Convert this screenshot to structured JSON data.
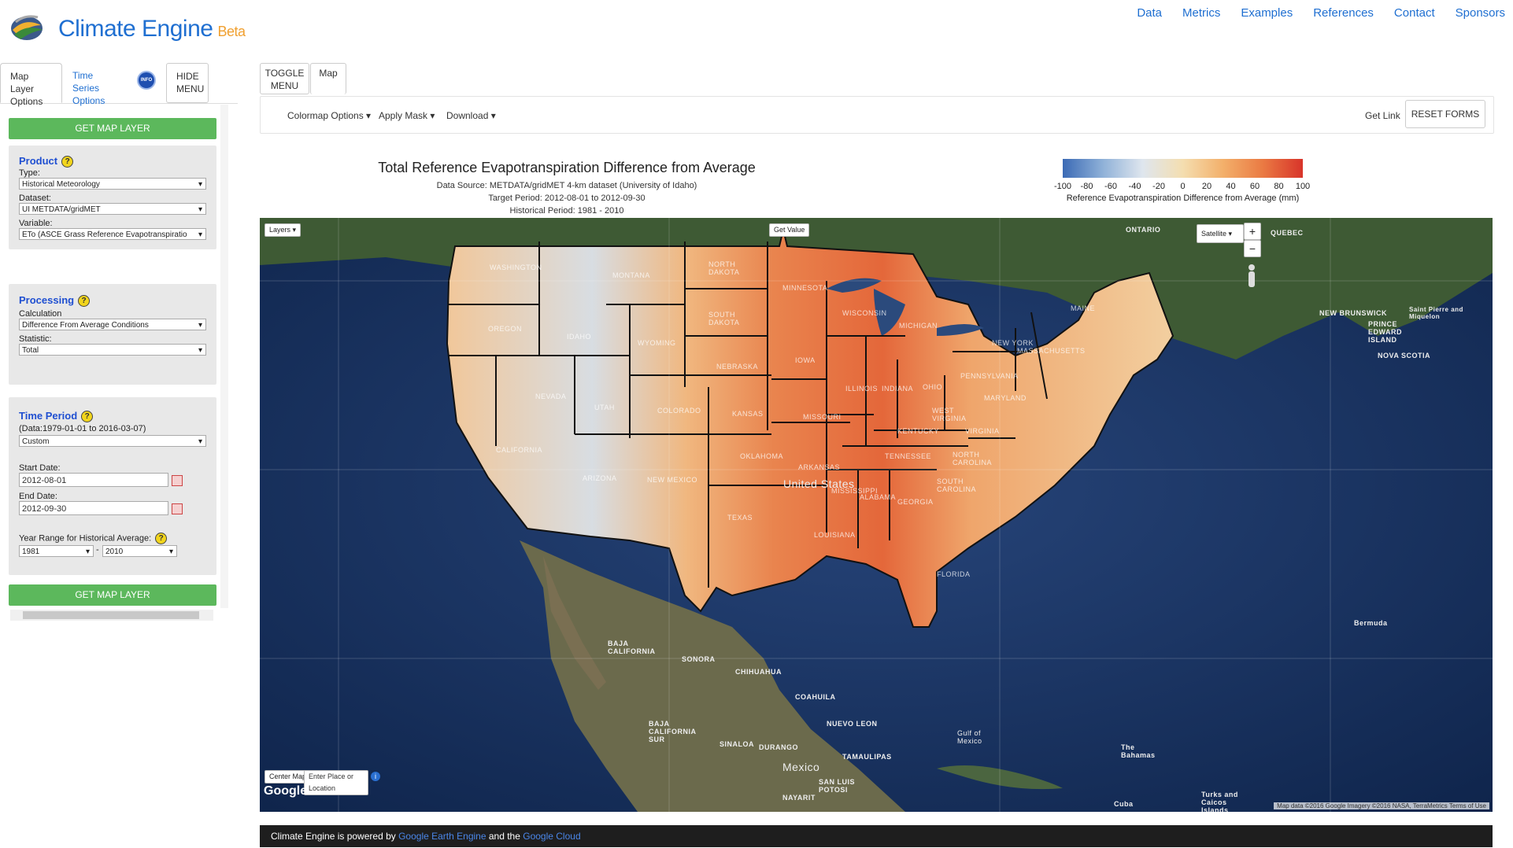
{
  "header": {
    "app_title": "Climate Engine",
    "beta": "Beta",
    "nav": [
      "Data",
      "Metrics",
      "Examples",
      "References",
      "Contact",
      "Sponsors"
    ]
  },
  "left_panel": {
    "tab_map_layer": "Map Layer Options",
    "tab_time_series": "Time Series Options",
    "info_icon_text": "INFO",
    "hide_menu": "HIDE MENU",
    "get_map_layer": "GET MAP LAYER",
    "product": {
      "title": "Product",
      "type_label": "Type:",
      "type_value": "Historical Meteorology",
      "dataset_label": "Dataset:",
      "dataset_value": "UI METDATA/gridMET",
      "variable_label": "Variable:",
      "variable_value": "ETo (ASCE Grass Reference Evapotranspiratio"
    },
    "processing": {
      "title": "Processing",
      "calculation_label": "Calculation",
      "calculation_value": "Difference From Average Conditions",
      "statistic_label": "Statistic:",
      "statistic_value": "Total"
    },
    "time_period": {
      "title": "Time Period",
      "data_range": "(Data:1979-01-01 to 2016-03-07)",
      "period_value": "Custom",
      "start_label": "Start Date:",
      "start_value": "2012-08-01",
      "end_label": "End Date:",
      "end_value": "2012-09-30",
      "year_range_label": "Year Range for Historical Average:",
      "year_start": "1981",
      "year_dash": "-",
      "year_end": "2010"
    }
  },
  "right_panel": {
    "toggle_menu": "TOGGLE MENU",
    "map_tab": "Map",
    "toolbar": {
      "colormap": "Colormap Options",
      "apply_mask": "Apply Mask",
      "download": "Download",
      "get_link": "Get Link",
      "reset_forms": "RESET FORMS"
    },
    "map_title": "Total Reference Evapotranspiration Difference from Average",
    "data_source": "Data Source: METDATA/gridMET 4-km dataset (University of Idaho)",
    "target_period": "Target Period: 2012-08-01 to 2012-09-30",
    "historical_period": "Historical Period: 1981 - 2010",
    "colorbar": {
      "ticks": [
        "-100",
        "-80",
        "-60",
        "-40",
        "-20",
        "0",
        "20",
        "40",
        "60",
        "80",
        "100"
      ],
      "label": "Reference Evapotranspiration Difference from Average (mm)",
      "colors": [
        "#3b6ab5",
        "#8fb1d8",
        "#dfe6ee",
        "#f4deb0",
        "#f3b06b",
        "#ea7a43",
        "#d8342a"
      ]
    },
    "map": {
      "layers_btn": "Layers",
      "get_value_btn": "Get Value",
      "satellite_select": "Satellite",
      "zoom_in": "+",
      "zoom_out": "−",
      "center_map_btn": "Center Map",
      "search_placeholder": "Enter Place or Location",
      "google": "Google",
      "attribution": "Map data ©2016 Google Imagery ©2016 NASA, TerraMetrics   Terms of Use",
      "country_label": "United States",
      "mexico_label": "Mexico",
      "place_labels": [
        "ONTARIO",
        "QUEBEC",
        "NEW BRUNSWICK",
        "PRINCE EDWARD ISLAND",
        "NOVA SCOTIA",
        "Saint Pierre and Miquelon",
        "Bermuda",
        "BAJA CALIFORNIA",
        "SONORA",
        "CHIHUAHUA",
        "COAHUILA",
        "NUEVO LEON",
        "BAJA CALIFORNIA SUR",
        "SINALOA",
        "DURANGO",
        "TAMAULIPAS",
        "NAYARIT",
        "SAN LUIS POTOSI",
        "Gulf of Mexico",
        "Cuba",
        "The Bahamas",
        "Turks and Caicos Islands"
      ],
      "state_labels": [
        "WASHINGTON",
        "OREGON",
        "CALIFORNIA",
        "NEVADA",
        "IDAHO",
        "MONTANA",
        "WYOMING",
        "UTAH",
        "ARIZONA",
        "COLORADO",
        "NEW MEXICO",
        "NORTH DAKOTA",
        "SOUTH DAKOTA",
        "NEBRASKA",
        "KANSAS",
        "OKLAHOMA",
        "TEXAS",
        "MINNESOTA",
        "IOWA",
        "MISSOURI",
        "ARKANSAS",
        "LOUISIANA",
        "WISCONSIN",
        "ILLINOIS",
        "MICHIGAN",
        "INDIANA",
        "OHIO",
        "KENTUCKY",
        "TENNESSEE",
        "MISSISSIPPI",
        "ALABAMA",
        "GEORGIA",
        "FLORIDA",
        "SOUTH CAROLINA",
        "NORTH CAROLINA",
        "VIRGINIA",
        "WEST VIRGINIA",
        "PENNSYLVANIA",
        "NEW YORK",
        "MAINE",
        "MARYLAND",
        "MASSACHUSETTS"
      ]
    },
    "footer": {
      "prefix": "Climate Engine is powered by ",
      "link1": "Google Earth Engine",
      "mid": " and the ",
      "link2": "Google Cloud"
    }
  }
}
